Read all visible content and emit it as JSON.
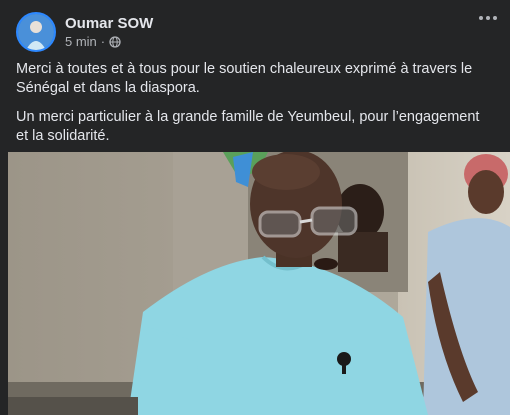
{
  "post": {
    "author": "Oumar SOW",
    "time": "5 min",
    "separator": "·",
    "privacy_icon": "globe-icon",
    "menu_icon": "more-options-icon",
    "paragraphs": [
      "Merci à toutes et à tous pour le soutien chaleureux exprimé à travers le Sénégal et dans la diaspora.",
      "Un merci particulier à la grande famille de Yeumbeul, pour l’engagement et la solidarité."
    ]
  },
  "colors": {
    "card_bg": "#242526",
    "text_primary": "#e4e6eb",
    "text_secondary": "#b0b3b8",
    "avatar_ring": "#2d88ff",
    "shirt": "#8fd6e3"
  }
}
